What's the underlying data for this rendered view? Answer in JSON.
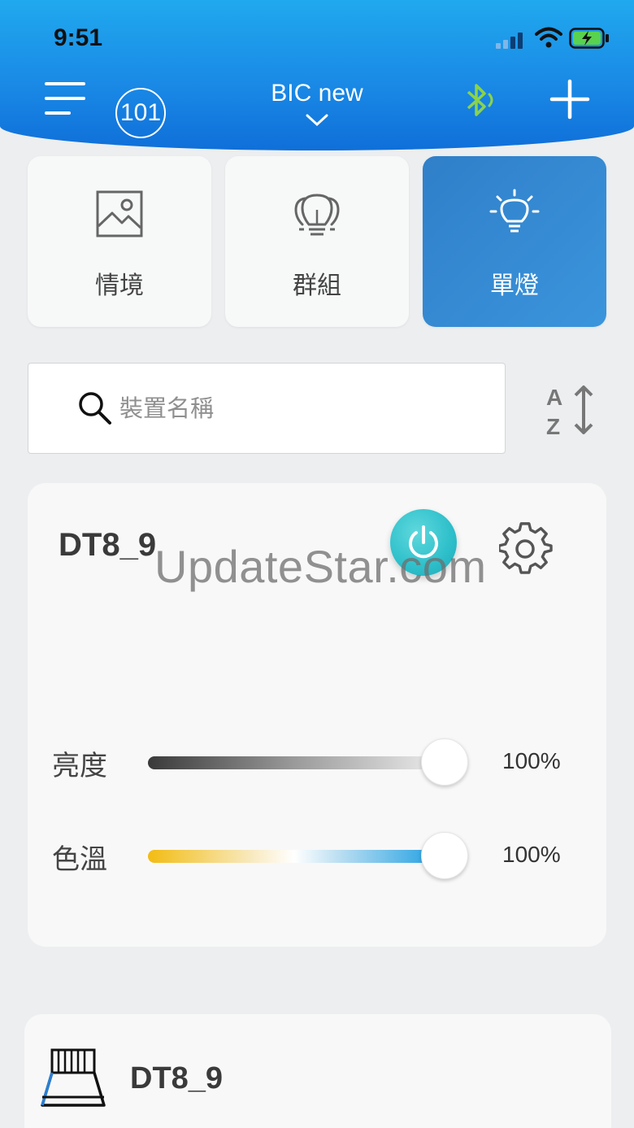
{
  "status_bar": {
    "time": "9:51"
  },
  "header": {
    "badge": "101",
    "title": "BIC new",
    "icons": [
      "menu-icon",
      "chevron-down-icon",
      "bluetooth-icon",
      "plus-icon"
    ],
    "bluetooth_color": "#8bd34a"
  },
  "tabs": [
    {
      "label": "情境",
      "icon": "image-icon",
      "active": false
    },
    {
      "label": "群組",
      "icon": "bulbs-group-icon",
      "active": false
    },
    {
      "label": "單燈",
      "icon": "bulb-icon",
      "active": true
    }
  ],
  "search": {
    "placeholder": "裝置名稱",
    "value": ""
  },
  "sort_icon": "sort-az-icon",
  "devices": [
    {
      "name": "DT8_9",
      "power": "on",
      "power_color": "#2dbfca",
      "watermark": "UpdateStar.com",
      "brightness": {
        "label": "亮度",
        "value_text": "100%",
        "value": 100
      },
      "color_temp": {
        "label": "色溫",
        "value_text": "100%",
        "value": 100
      }
    },
    {
      "name": "DT8_9",
      "icon": "downlight-icon"
    }
  ],
  "colors": {
    "header_blue": "#1a8ae6",
    "active_tab": "#3b8fd6"
  }
}
